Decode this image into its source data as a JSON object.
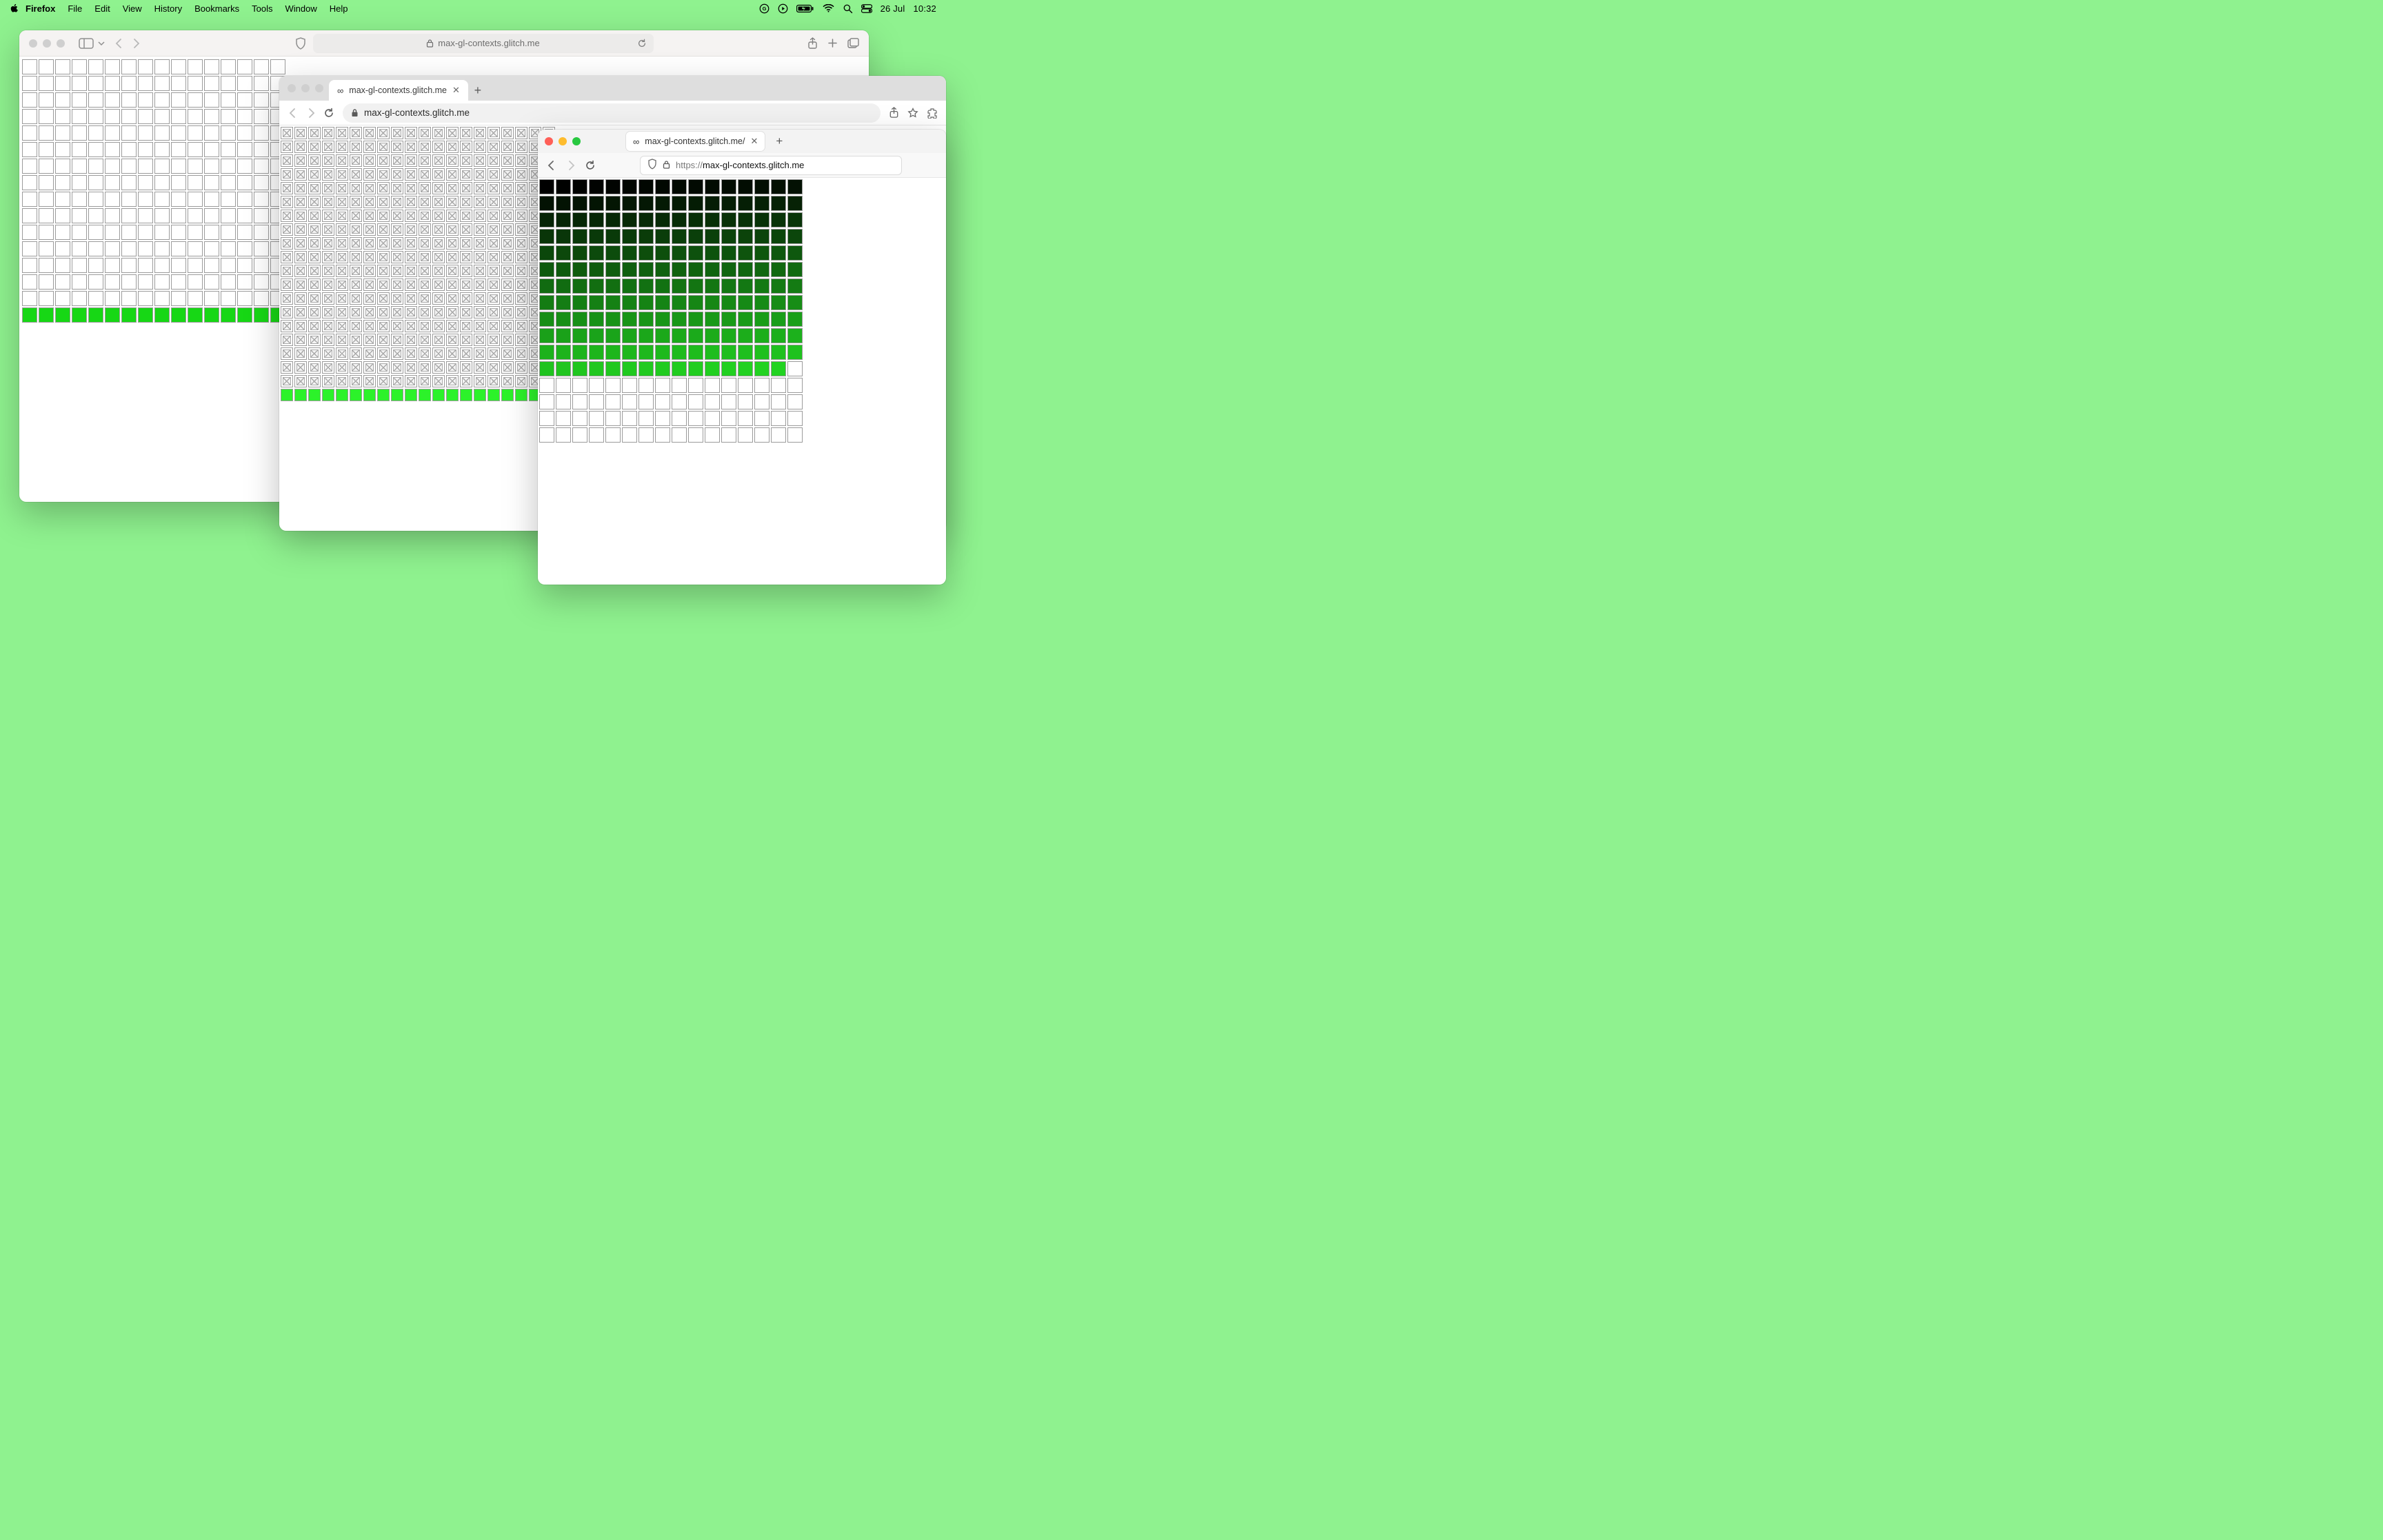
{
  "menubar": {
    "app": "Firefox",
    "items": [
      "File",
      "Edit",
      "View",
      "History",
      "Bookmarks",
      "Tools",
      "Window",
      "Help"
    ],
    "date": "26 Jul",
    "time": "10:32"
  },
  "safari": {
    "host": "max-gl-contexts.glitch.me",
    "grid": {
      "cols": 16,
      "rows": 16,
      "empty_rows": 15,
      "green_cells": 16,
      "green_color": "#17d715",
      "cell": 22
    }
  },
  "chrome": {
    "tab_title": "max-gl-contexts.glitch.me",
    "url_display": "max-gl-contexts.glitch.me",
    "grid": {
      "cols": 20,
      "rows": 20,
      "broken_rows": 19,
      "green_cells": 20,
      "green_color": "#2cf22a",
      "cell": 18
    }
  },
  "firefox": {
    "tab_title": "max-gl-contexts.glitch.me/",
    "url_scheme": "https://",
    "url_host": "max-gl-contexts.glitch.me",
    "grid": {
      "cols": 16,
      "rows": 16,
      "gradient_cells": 191,
      "empty_cells": 65,
      "gradient_start": "#000000",
      "gradient_end": "#22d321",
      "cell": 22
    }
  }
}
